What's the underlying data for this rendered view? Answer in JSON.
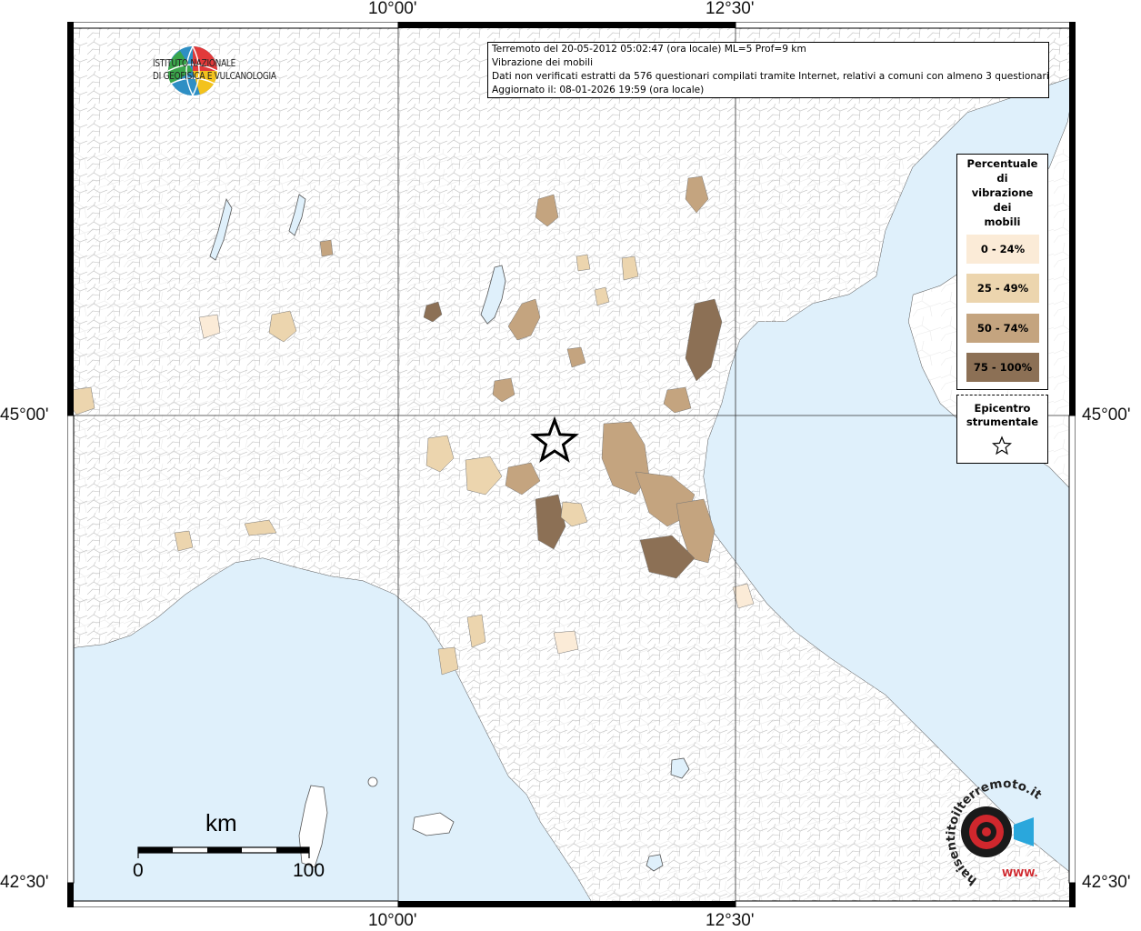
{
  "axes": {
    "top_ticks": [
      "10°00'",
      "12°30'"
    ],
    "bottom_ticks": [
      "10°00'",
      "12°30'"
    ],
    "left_ticks": [
      "45°00'",
      "42°30'"
    ],
    "right_ticks": [
      "45°00'",
      "42°30'"
    ]
  },
  "logo": {
    "line1": "ISTITUTO NAZIONALE",
    "line2": "DI GEOFISICA E VULCANOLOGIA"
  },
  "info": {
    "line1": "Terremoto del 20-05-2012 05:02:47 (ora locale) ML=5 Prof=9 km",
    "line2": "Vibrazione dei mobili",
    "line3": "Dati non verificati estratti da 576 questionari compilati tramite Internet, relativi a comuni con almeno 3 questionari.",
    "line4": "Aggiornato il: 08-01-2026 19:59 (ora locale)"
  },
  "legend": {
    "title_lines": [
      "Percentuale",
      "di",
      "vibrazione",
      "dei",
      "mobili"
    ],
    "items": [
      {
        "label": "0 - 24%",
        "color": "#fbebd7"
      },
      {
        "label": "25 - 49%",
        "color": "#ecd5ae"
      },
      {
        "label": "50 - 74%",
        "color": "#c4a47f"
      },
      {
        "label": "75 - 100%",
        "color": "#8c7055"
      }
    ]
  },
  "epicenter": {
    "title_lines": [
      "Epicentro",
      "strumentale"
    ],
    "icon": "star-icon"
  },
  "scale_bar": {
    "unit": "km",
    "start": "0",
    "end": "100"
  },
  "badge": {
    "text": "haisentitoilterremoto.it",
    "prefix": "WWW.",
    "icon": "sound-target-icon"
  },
  "colors": {
    "sea": "#dff0fb",
    "land": "#ffffff",
    "border": "#9e9e9e"
  }
}
